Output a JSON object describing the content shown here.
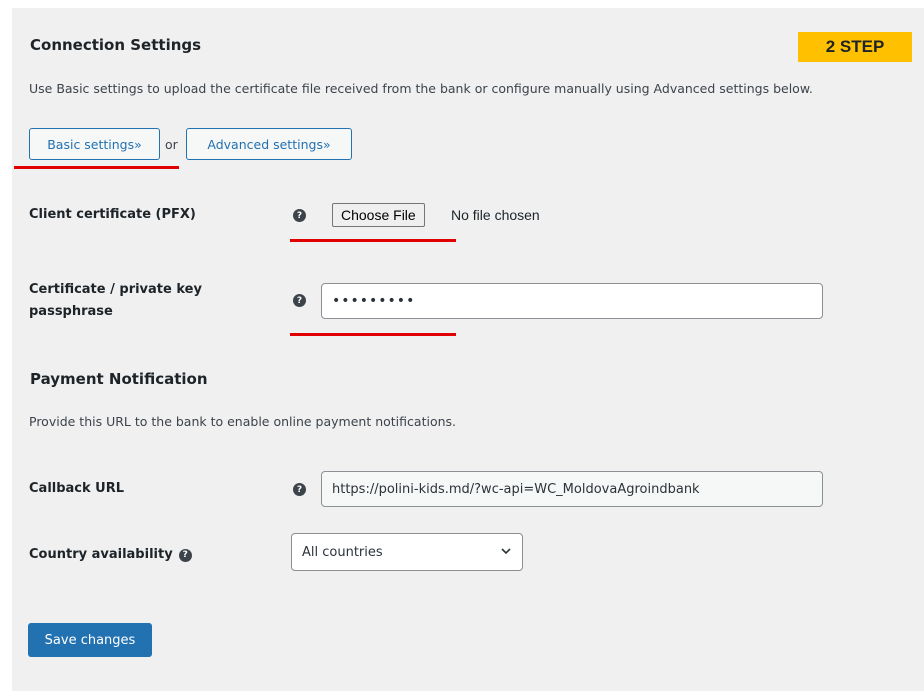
{
  "connection": {
    "heading": "Connection Settings",
    "step_badge": "2 STEP",
    "description": "Use Basic settings to upload the certificate file received from the bank or configure manually using Advanced settings below.",
    "basic_button": "Basic settings»",
    "or_text": "or",
    "advanced_button": "Advanced settings»"
  },
  "fields": {
    "client_certificate": {
      "label": "Client certificate (PFX)",
      "help_icon": "question-circle-icon",
      "button": "Choose File",
      "status": "No file chosen"
    },
    "passphrase": {
      "label_line1": "Certificate / private key",
      "label_line2": "passphrase",
      "value": "•••••••••"
    }
  },
  "payment_notification": {
    "heading": "Payment Notification",
    "description": "Provide this URL to the bank to enable online payment notifications.",
    "callback_label": "Callback URL",
    "callback_value": "https://polini-kids.md/?wc-api=WC_MoldovaAgroindbank"
  },
  "country": {
    "label": "Country availability",
    "selected": "All countries"
  },
  "actions": {
    "save_button": "Save changes"
  },
  "colors": {
    "accent": "#2271b1",
    "badge": "#ffc000",
    "underline": "#e00000",
    "panel_bg": "#f0f0f1"
  }
}
